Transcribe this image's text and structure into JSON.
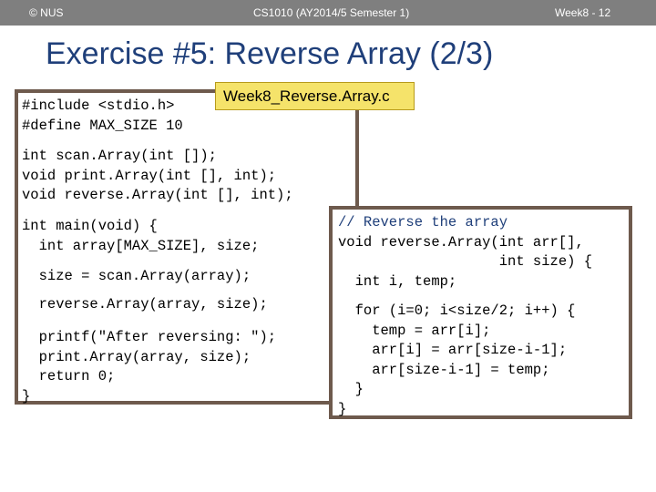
{
  "header": {
    "left": "© NUS",
    "center": "CS1010 (AY2014/5 Semester 1)",
    "right": "Week8 - 12"
  },
  "title": "Exercise #5: Reverse Array (2/3)",
  "file_label": "Week8_Reverse.Array.c",
  "left_code": {
    "l1": "#include <stdio.h>",
    "l2": "#define MAX_SIZE 10",
    "l3": "int scan.Array(int []);",
    "l4": "void print.Array(int [], int);",
    "l5": "void reverse.Array(int [], int);",
    "l6": "int main(void) {",
    "l7": "  int array[MAX_SIZE], size;",
    "l8": "  size = scan.Array(array);",
    "l9": "  reverse.Array(array, size);",
    "l10": "  printf(\"After reversing: \");",
    "l11": "  print.Array(array, size);",
    "l12": "  return 0;",
    "l13": "}"
  },
  "right_code": {
    "l1": "// Reverse the array",
    "l2": "void reverse.Array(int arr[],",
    "l3": "                   int size) {",
    "l4": "  int i, temp;",
    "l5": "  for (i=0; i<size/2; i++) {",
    "l6": "    temp = arr[i];",
    "l7": "    arr[i] = arr[size-i-1];",
    "l8": "    arr[size-i-1] = temp;",
    "l9": "  }",
    "l10": "}"
  },
  "colors": {
    "header_bg": "#7f7f7f",
    "title": "#1f3f7a",
    "box_border": "#6e5a4d",
    "file_label_bg": "#f5e36a"
  }
}
